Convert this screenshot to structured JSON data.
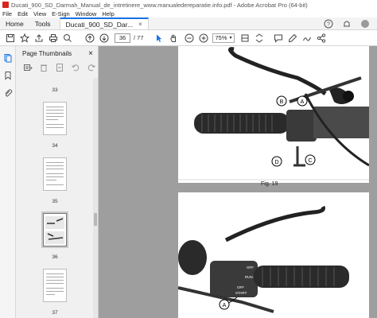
{
  "window": {
    "title": "Ducati_900_SD_Darmah_Manual_de_intretinere_www.manualedereparatie.info.pdf - Adobe Acrobat Pro (64-bit)"
  },
  "menu": [
    "File",
    "Edit",
    "View",
    "E-Sign",
    "Window",
    "Help"
  ],
  "tabs": {
    "home": "Home",
    "tools": "Tools",
    "document": "Ducati_900_SD_Dar...",
    "close": "×"
  },
  "toolbar": {
    "current_page": "36",
    "total_pages": "/ 77",
    "zoom": "75%"
  },
  "thumbnails": {
    "title": "Page Thumbnails",
    "close": "×",
    "pages": [
      {
        "label": "33"
      },
      {
        "label": "34"
      },
      {
        "label": "35"
      },
      {
        "label": "36",
        "selected": true
      },
      {
        "label": "37"
      }
    ]
  },
  "document": {
    "figure_caption": "Fig. 19",
    "callouts_top": [
      "A",
      "B",
      "C",
      "D"
    ],
    "callouts_bottom": [
      "A"
    ],
    "switch_labels": [
      "OFF",
      "RUN",
      "OFF",
      "START"
    ]
  },
  "colors": {
    "accent": "#1473e6",
    "app_red": "#d7261f",
    "doc_background": "#9e9e9e"
  }
}
